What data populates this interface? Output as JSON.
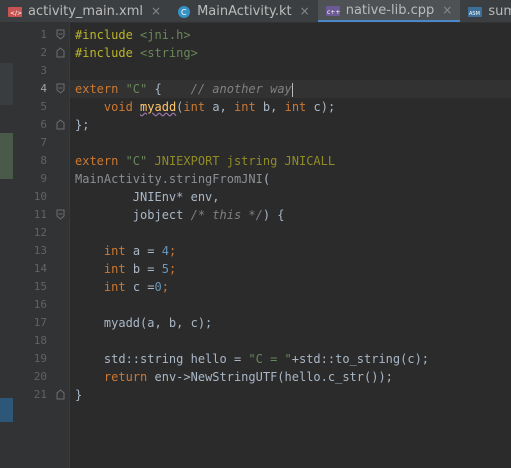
{
  "tabs": [
    {
      "label": "activity_main.xml",
      "icon": "xml-file-icon",
      "active": false,
      "closable": true
    },
    {
      "label": "MainActivity.kt",
      "icon": "kotlin-class-icon",
      "active": false,
      "closable": true
    },
    {
      "label": "native-lib.cpp",
      "icon": "cpp-file-icon",
      "active": true,
      "closable": true
    },
    {
      "label": "sum.s",
      "icon": "asm-file-icon",
      "active": false,
      "closable": false
    }
  ],
  "close_glyph": "×",
  "editor": {
    "current_line": 4,
    "line_numbers": [
      "1",
      "2",
      "3",
      "4",
      "5",
      "6",
      "7",
      "8",
      "9",
      "10",
      "11",
      "12",
      "13",
      "14",
      "15",
      "16",
      "17",
      "18",
      "19",
      "20",
      "21"
    ],
    "code": {
      "l1_directive": "#include",
      "l1_header": " <jni.h>",
      "l2_directive": "#include",
      "l2_header": " <string>",
      "l4_extern": "extern",
      "l4_c": " \"C\"",
      "l4_brace": " {    ",
      "l4_comment": "// another way",
      "l5_indent": "    ",
      "l5_void": "void",
      "l5_sp": " ",
      "l5_name": "myadd",
      "l5_paren": "(",
      "l5_int1": "int",
      "l5_a": " a, ",
      "l5_int2": "int",
      "l5_b": " b, ",
      "l5_int3": "int",
      "l5_c": " c);",
      "l6": "};",
      "l8_extern": "extern",
      "l8_c": " \"C\"",
      "l8_rest": " JNIEXPORT jstring JNICALL",
      "l9_name": "MainActivity.stringFromJNI",
      "l9_paren": "(",
      "l10": "        JNIEnv* env,",
      "l11_indent": "        jobject ",
      "l11_comment": "/* this */",
      "l11_end": ") {",
      "l13_indent": "    ",
      "l13_int": "int",
      "l13_mid": " a = ",
      "l13_num": "4",
      "l13_end": ";",
      "l14_indent": "    ",
      "l14_int": "int",
      "l14_mid": " b = ",
      "l14_num": "5",
      "l14_end": ";",
      "l15_indent": "    ",
      "l15_int": "int",
      "l15_mid": " c =",
      "l15_num": "0",
      "l15_end": ";",
      "l17": "    myadd(a, b, c);",
      "l19_pre": "    std::string hello = ",
      "l19_str": "\"C = \"",
      "l19_post": "+std::to_string(c);",
      "l20_indent": "    ",
      "l20_return": "return",
      "l20_rest": " env->NewStringUTF(hello.c_str());",
      "l21": "}"
    }
  },
  "colors": {
    "background": "#2b2b2b",
    "keyword": "#cc7832",
    "string": "#6a8759",
    "number": "#6897bb",
    "preprocessor": "#bbb529",
    "comment": "#808080",
    "active_tab_underline": "#4a88c7"
  }
}
